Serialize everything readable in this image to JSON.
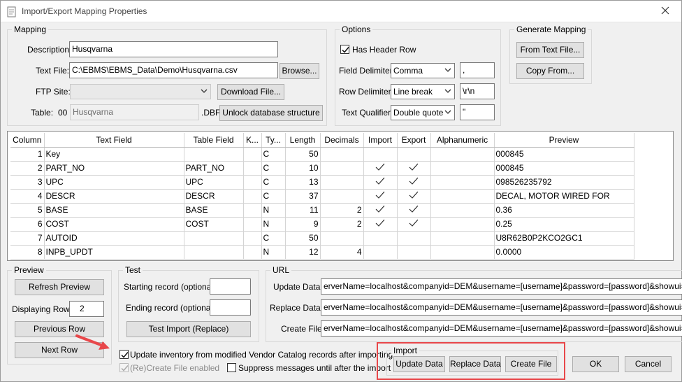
{
  "window": {
    "title": "Import/Export Mapping Properties"
  },
  "mapping": {
    "group_label": "Mapping",
    "description_label": "Description:",
    "description_value": "Husqvarna",
    "textfile_label": "Text File:",
    "textfile_value": "C:\\EBMS\\EBMS_Data\\Demo\\Husqvarna.csv",
    "browse_label": "Browse...",
    "ftp_label": "FTP Site:",
    "ftp_value": "",
    "download_label": "Download File...",
    "table_label": "Table:",
    "table_prefix": "00",
    "table_value": "Husqvarna",
    "table_ext": ".DBF",
    "unlock_label": "Unlock database structure"
  },
  "options": {
    "group_label": "Options",
    "has_header_label": "Has Header Row",
    "has_header_checked": true,
    "field_delim_label": "Field Delimiter:",
    "field_delim_value": "Comma",
    "field_delim_char": ",",
    "row_delim_label": "Row Delimiter:",
    "row_delim_value": "Line break",
    "row_delim_char": "\\r\\n",
    "text_qual_label": "Text Qualifier:",
    "text_qual_value": "Double quote",
    "text_qual_char": "\""
  },
  "generate": {
    "group_label": "Generate Mapping",
    "from_text_label": "From Text File...",
    "copy_from_label": "Copy From..."
  },
  "grid": {
    "headers": [
      "Column",
      "Text Field",
      "Table Field",
      "K...",
      "Ty...",
      "Length",
      "Decimals",
      "Import",
      "Export",
      "Alphanumeric",
      "Preview"
    ],
    "rows": [
      {
        "column": "1",
        "text_field": "Key",
        "table_field": "",
        "key": "",
        "type": "C",
        "length": "50",
        "decimals": "",
        "import": false,
        "export": false,
        "alpha": "",
        "preview": "000845"
      },
      {
        "column": "2",
        "text_field": "PART_NO",
        "table_field": "PART_NO",
        "key": "",
        "type": "C",
        "length": "10",
        "decimals": "",
        "import": true,
        "export": true,
        "alpha": "",
        "preview": "000845"
      },
      {
        "column": "3",
        "text_field": "UPC",
        "table_field": "UPC",
        "key": "",
        "type": "C",
        "length": "13",
        "decimals": "",
        "import": true,
        "export": true,
        "alpha": "",
        "preview": "098526235792"
      },
      {
        "column": "4",
        "text_field": "DESCR",
        "table_field": "DESCR",
        "key": "",
        "type": "C",
        "length": "37",
        "decimals": "",
        "import": true,
        "export": true,
        "alpha": "",
        "preview": "DECAL, MOTOR WIRED FOR"
      },
      {
        "column": "5",
        "text_field": "BASE",
        "table_field": "BASE",
        "key": "",
        "type": "N",
        "length": "11",
        "decimals": "2",
        "import": true,
        "export": true,
        "alpha": "",
        "preview": "0.36"
      },
      {
        "column": "6",
        "text_field": "COST",
        "table_field": "COST",
        "key": "",
        "type": "N",
        "length": "9",
        "decimals": "2",
        "import": true,
        "export": true,
        "alpha": "",
        "preview": "0.25"
      },
      {
        "column": "7",
        "text_field": "AUTOID",
        "table_field": "",
        "key": "",
        "type": "C",
        "length": "50",
        "decimals": "",
        "import": false,
        "export": false,
        "alpha": "",
        "preview": "U8R62B0P2KCO2GC1"
      },
      {
        "column": "8",
        "text_field": "INPB_UPDT",
        "table_field": "",
        "key": "",
        "type": "N",
        "length": "12",
        "decimals": "4",
        "import": false,
        "export": false,
        "alpha": "",
        "preview": "0.0000"
      }
    ]
  },
  "preview": {
    "group_label": "Preview",
    "refresh_label": "Refresh Preview",
    "displaying_label": "Displaying Row",
    "displaying_value": "2",
    "previous_label": "Previous Row",
    "next_label": "Next Row"
  },
  "test": {
    "group_label": "Test",
    "starting_label": "Starting record (optional):",
    "starting_value": "",
    "ending_label": "Ending record (optional):",
    "ending_value": "",
    "test_import_label": "Test Import (Replace)"
  },
  "url": {
    "group_label": "URL",
    "update_label": "Update Data:",
    "update_value": "erverName=localhost&companyid=DEM&username=[username]&password=[password]&showui=false&Connect",
    "replace_label": "Replace Data:",
    "replace_value": "erverName=localhost&companyid=DEM&username=[username]&password=[password]&showui=false&Connect",
    "create_label": "Create File:",
    "create_value": "erverName=localhost&companyid=DEM&username=[username]&password=[password]&showui=false&Connect"
  },
  "footer": {
    "update_inventory_label": "Update inventory from modified Vendor Catalog records after importing",
    "update_inventory_checked": true,
    "recreate_label": "(Re)Create File enabled",
    "recreate_checked": true,
    "suppress_label": "Suppress messages until after the import",
    "suppress_checked": false
  },
  "import": {
    "group_label": "Import",
    "update_label": "Update Data",
    "replace_label": "Replace Data",
    "create_label": "Create File"
  },
  "dialog": {
    "ok_label": "OK",
    "cancel_label": "Cancel"
  },
  "colors": {
    "accent_red": "#e8474a",
    "window_bg": "#f0f0f0"
  }
}
